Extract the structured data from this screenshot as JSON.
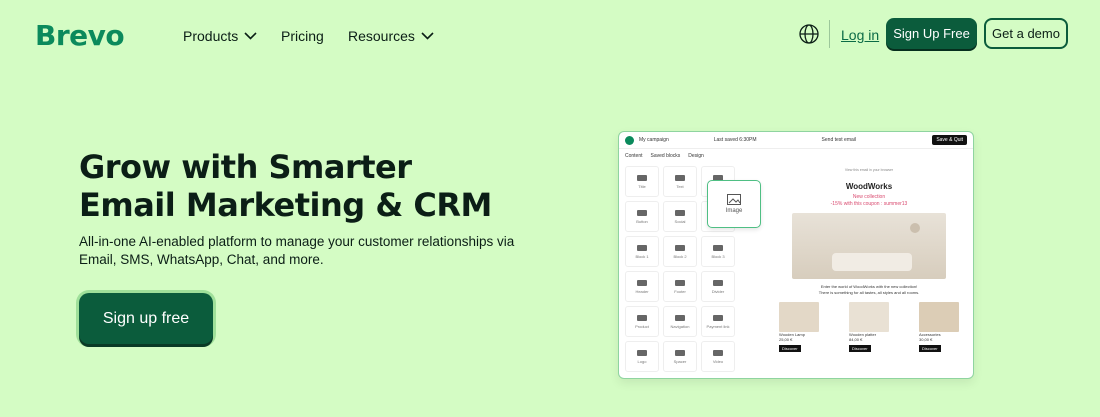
{
  "nav": {
    "logo": "Brevo",
    "items": [
      {
        "label": "Products",
        "dropdown": true
      },
      {
        "label": "Pricing",
        "dropdown": false
      },
      {
        "label": "Resources",
        "dropdown": true
      }
    ],
    "login": "Log in",
    "signup": "Sign Up Free",
    "demo": "Get a demo"
  },
  "hero": {
    "title_line1": "Grow with Smarter",
    "title_line2": "Email Marketing & CRM",
    "subtitle": "All-in-one AI-enabled platform to manage your customer relationships via Email, SMS, WhatsApp, Chat, and more.",
    "cta": "Sign up free"
  },
  "mock": {
    "campaign": "My campaign",
    "saved": "Last saved 6:30PM",
    "send_test": "Send test email",
    "save_quit": "Save & Quit",
    "tabs": [
      "Content",
      "Saved blocks",
      "Design"
    ],
    "blocks": [
      "Title",
      "Text",
      "Image",
      "Button",
      "Social",
      "",
      "Block 1",
      "Block 2",
      "Block 3",
      "Header",
      "Footer",
      "Divider",
      "Product",
      "Navigation",
      "Payment link",
      "Logo",
      "Spacer",
      "Video"
    ],
    "popup_label": "Image",
    "email_top": "View this email in your browser",
    "brand": "WoodWorks",
    "promo_line1": "New collection",
    "promo_line2": "-15% with this coupon : summer13",
    "body_line1": "Enter the world of WoodWorks with the new collection!",
    "body_line2": "There is something for all tastes, all styles and all rooms.",
    "products": [
      {
        "name": "Wooden Lamp",
        "price": "25,00 €",
        "button": "Discover"
      },
      {
        "name": "Wooden platter",
        "price": "84,00 €",
        "button": "Discover"
      },
      {
        "name": "Accessories",
        "price": "30,00 €",
        "button": "Discover"
      }
    ]
  },
  "colors": {
    "background": "#d4fcc4",
    "brand": "#0b8a5c",
    "button": "#0b5c3c"
  }
}
